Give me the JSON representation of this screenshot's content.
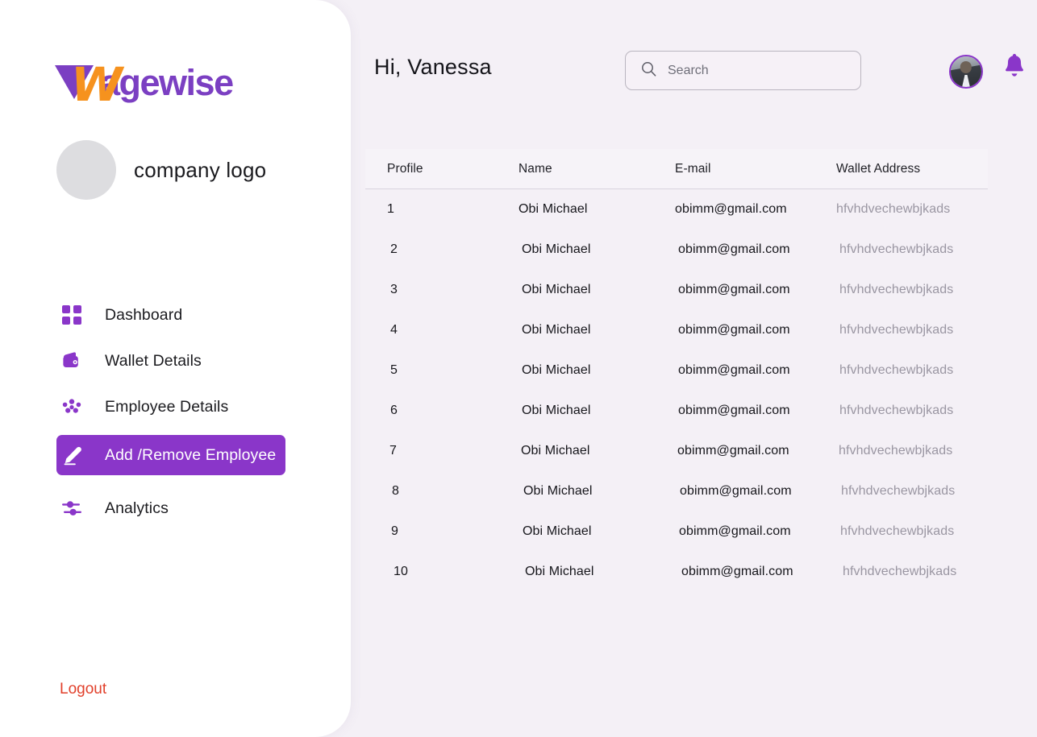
{
  "brand": {
    "word": "agewise",
    "mark_icon": "wagewise-logo-icon"
  },
  "sidebar": {
    "company": {
      "label": "company logo",
      "avatar_icon": "company-logo-placeholder-icon"
    },
    "items": [
      {
        "label": "Dashboard",
        "icon": "grid-icon",
        "active": false
      },
      {
        "label": "Wallet Details",
        "icon": "wallet-icon",
        "active": false
      },
      {
        "label": "Employee Details",
        "icon": "people-icon",
        "active": false
      },
      {
        "label": "Add /Remove Employee",
        "icon": "pencil-icon",
        "active": true
      },
      {
        "label": "Analytics",
        "icon": "sliders-icon",
        "active": false
      }
    ],
    "logout_label": "Logout"
  },
  "header": {
    "greeting": "Hi, Vanessa",
    "search_placeholder": "Search",
    "search_value": "",
    "search_icon": "search-icon",
    "avatar_icon": "user-avatar",
    "bell_icon": "bell-icon"
  },
  "table": {
    "columns": [
      "Profile",
      "Name",
      "E-mail",
      "Wallet Address"
    ],
    "rows": [
      {
        "profile": "1",
        "name": "Obi Michael",
        "email": "obimm@gmail.com",
        "wallet": "hfvhdvechewbjkads"
      },
      {
        "profile": "2",
        "name": "Obi Michael",
        "email": "obimm@gmail.com",
        "wallet": "hfvhdvechewbjkads"
      },
      {
        "profile": "3",
        "name": "Obi Michael",
        "email": "obimm@gmail.com",
        "wallet": "hfvhdvechewbjkads"
      },
      {
        "profile": "4",
        "name": "Obi Michael",
        "email": "obimm@gmail.com",
        "wallet": "hfvhdvechewbjkads"
      },
      {
        "profile": "5",
        "name": "Obi Michael",
        "email": "obimm@gmail.com",
        "wallet": "hfvhdvechewbjkads"
      },
      {
        "profile": "6",
        "name": "Obi Michael",
        "email": "obimm@gmail.com",
        "wallet": "hfvhdvechewbjkads"
      },
      {
        "profile": "7",
        "name": "Obi Michael",
        "email": "obimm@gmail.com",
        "wallet": "hfvhdvechewbjkads"
      },
      {
        "profile": "8",
        "name": "Obi Michael",
        "email": "obimm@gmail.com",
        "wallet": "hfvhdvechewbjkads"
      },
      {
        "profile": "9",
        "name": "Obi Michael",
        "email": "obimm@gmail.com",
        "wallet": "hfvhdvechewbjkads"
      },
      {
        "profile": "10",
        "name": "Obi Michael",
        "email": "obimm@gmail.com",
        "wallet": "hfvhdvechewbjkads"
      }
    ]
  },
  "colors": {
    "brand_purple": "#7b3fc2",
    "accent_purple": "#8a36c9",
    "brand_orange": "#f6921e",
    "logout_red": "#e1402b",
    "page_bg": "#f4f0f6",
    "sidebar_bg": "#ffffff",
    "wallet_text": "#9a96a2"
  }
}
